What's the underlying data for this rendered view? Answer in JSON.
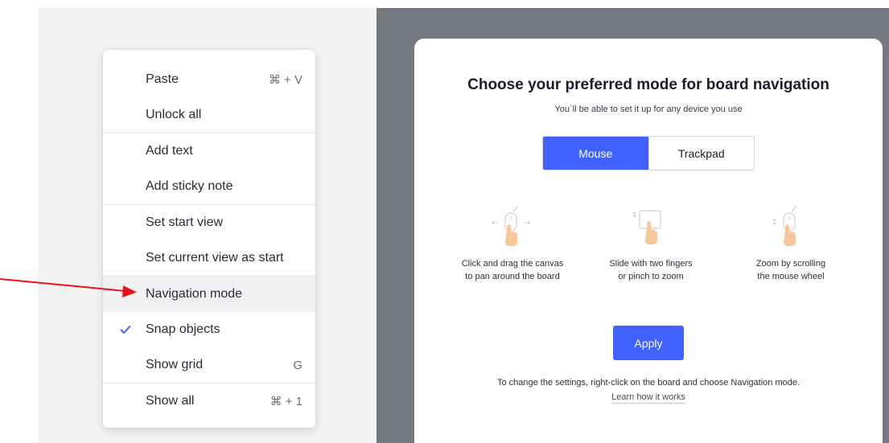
{
  "context_menu": {
    "items": [
      {
        "label": "Paste",
        "shortcut": "⌘ + V"
      },
      {
        "label": "Unlock all",
        "shortcut": ""
      },
      {
        "label": "Add text",
        "shortcut": ""
      },
      {
        "label": "Add sticky note",
        "shortcut": ""
      },
      {
        "label": "Set start view",
        "shortcut": ""
      },
      {
        "label": "Set current view as start",
        "shortcut": ""
      },
      {
        "label": "Navigation mode",
        "shortcut": ""
      },
      {
        "label": "Snap objects",
        "shortcut": ""
      },
      {
        "label": "Show grid",
        "shortcut": "G"
      },
      {
        "label": "Show all",
        "shortcut": "⌘ + 1"
      }
    ]
  },
  "modal": {
    "title": "Choose your preferred mode for board navigation",
    "subtitle": "You`ll be able to set it up for any device you use",
    "tabs": [
      "Mouse",
      "Trackpad"
    ],
    "selected_tab": "Mouse",
    "options": [
      {
        "line1": "Click and drag the canvas",
        "line2": "to pan around the board"
      },
      {
        "line1": "Slide with two fingers",
        "line2": "or pinch to zoom"
      },
      {
        "line1": "Zoom by scrolling",
        "line2": "the mouse wheel"
      }
    ],
    "apply_label": "Apply",
    "footer": "To change the settings, right-click on the board and choose Navigation mode.",
    "learn_link": "Learn how it works"
  },
  "colors": {
    "accent": "#4262ff",
    "overlay": "#75787f",
    "arrow": "#e8131b",
    "hand": "#f6c79a"
  }
}
